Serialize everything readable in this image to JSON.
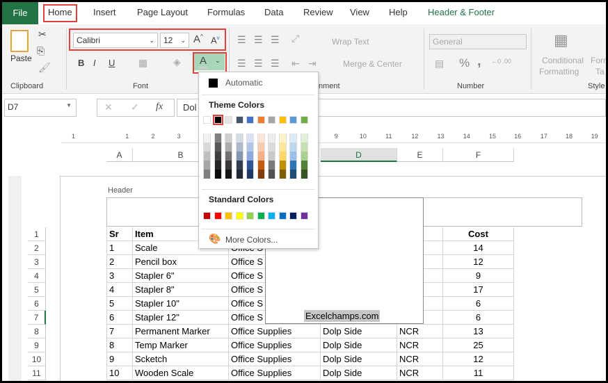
{
  "tabs": [
    "File",
    "Home",
    "Insert",
    "Page Layout",
    "Formulas",
    "Data",
    "Review",
    "View",
    "Help",
    "Header & Footer"
  ],
  "active_tab": "Home",
  "ribbon": {
    "clipboard": {
      "paste": "Paste",
      "label": "Clipboard"
    },
    "font": {
      "name": "Calibri",
      "size": "12",
      "bold": "B",
      "italic": "I",
      "underline": "U",
      "font_color_glyph": "A",
      "label": "Font"
    },
    "alignment": {
      "wrap_text": "Wrap Text",
      "merge_center": "Merge & Center",
      "label": "Alignment",
      "label_visible": "nment"
    },
    "number": {
      "format": "General",
      "percent": "%",
      "comma": ",",
      "label": "Number"
    },
    "styles": {
      "conditional_line1": "Conditional",
      "conditional_line2": "Formatting",
      "format_table_1": "Form",
      "format_table_2": "Ta",
      "label": "Styles",
      "label_visible": "Style"
    }
  },
  "formula_bar": {
    "name_box": "D7",
    "fx": "fx",
    "content": "Dol"
  },
  "ruler": {
    "ticks": [
      "1",
      "1",
      "2",
      "3",
      "9",
      "10",
      "11",
      "12",
      "13",
      "14",
      "15",
      "16",
      "17",
      "18",
      "19"
    ]
  },
  "columns": [
    "A",
    "B",
    "D",
    "E",
    "F"
  ],
  "selected_column": "D",
  "page": {
    "header_label": "Header",
    "header_center_text": "Excelchamps.com"
  },
  "rows": [
    {
      "n": "1",
      "cells": [
        "Sr",
        "Item",
        null,
        null,
        null,
        "Cost"
      ]
    },
    {
      "n": "2",
      "cells": [
        "1",
        "Scale",
        "Office S",
        null,
        null,
        "14"
      ]
    },
    {
      "n": "3",
      "cells": [
        "2",
        "Pencil box",
        "Office S",
        null,
        null,
        "12"
      ]
    },
    {
      "n": "4",
      "cells": [
        "3",
        "Stapler 6\"",
        "Office S",
        null,
        null,
        "9"
      ]
    },
    {
      "n": "5",
      "cells": [
        "4",
        "Stapler 8\"",
        "Office S",
        null,
        null,
        "17"
      ]
    },
    {
      "n": "6",
      "cells": [
        "5",
        "Stapler 10\"",
        "Office S",
        null,
        null,
        "6"
      ]
    },
    {
      "n": "7",
      "cells": [
        "6",
        "Stapler 12\"",
        "Office S",
        null,
        null,
        "6"
      ]
    },
    {
      "n": "8",
      "cells": [
        "7",
        "Permanent Marker",
        "Office Supplies",
        "Dolp Side",
        "NCR",
        "13"
      ]
    },
    {
      "n": "9",
      "cells": [
        "8",
        "Temp Marker",
        "Office Supplies",
        "Dolp Side",
        "NCR",
        "25"
      ]
    },
    {
      "n": "10",
      "cells": [
        "9",
        "Scketch",
        "Office Supplies",
        "Dolp Side",
        "NCR",
        "12"
      ]
    },
    {
      "n": "11",
      "cells": [
        "10",
        "Wooden Scale",
        "Office Supplies",
        "Dolp Side",
        "NCR",
        "11"
      ]
    }
  ],
  "color_menu": {
    "automatic": "Automatic",
    "theme_title": "Theme Colors",
    "theme_colors": [
      "#ffffff",
      "#000000",
      "#e7e6e6",
      "#44546a",
      "#4472c4",
      "#ed7d31",
      "#a5a5a5",
      "#ffc000",
      "#5b9bd5",
      "#70ad47"
    ],
    "theme_shades": [
      [
        "#f2f2f2",
        "#d9d9d9",
        "#bfbfbf",
        "#a6a6a6",
        "#808080"
      ],
      [
        "#808080",
        "#595959",
        "#404040",
        "#262626",
        "#0d0d0d"
      ],
      [
        "#d0cece",
        "#aeabab",
        "#757171",
        "#3a3838",
        "#171616"
      ],
      [
        "#d6dce4",
        "#adb9ca",
        "#8497b0",
        "#333f4f",
        "#222a35"
      ],
      [
        "#d9e1f2",
        "#b4c6e7",
        "#8ea9db",
        "#2f5597",
        "#1f3864"
      ],
      [
        "#fce4d6",
        "#f8cbad",
        "#f4b084",
        "#c55a11",
        "#843c0c"
      ],
      [
        "#ededed",
        "#dbdbdb",
        "#c9c9c9",
        "#7b7b7b",
        "#525252"
      ],
      [
        "#fff2cc",
        "#ffe699",
        "#ffd966",
        "#bf8f00",
        "#7f6000"
      ],
      [
        "#ddebf7",
        "#bdd7ee",
        "#9bc2e6",
        "#2e75b6",
        "#1f4e78"
      ],
      [
        "#e2efda",
        "#c6e0b4",
        "#a9d08e",
        "#548235",
        "#375623"
      ]
    ],
    "standard_title": "Standard Colors",
    "standard_colors": [
      "#c00000",
      "#ff0000",
      "#ffc000",
      "#ffff00",
      "#92d050",
      "#00b050",
      "#00b0f0",
      "#0070c0",
      "#002060",
      "#7030a0"
    ],
    "more_colors": "More Colors..."
  },
  "accent": "#217346",
  "highlight": "#e0413b"
}
